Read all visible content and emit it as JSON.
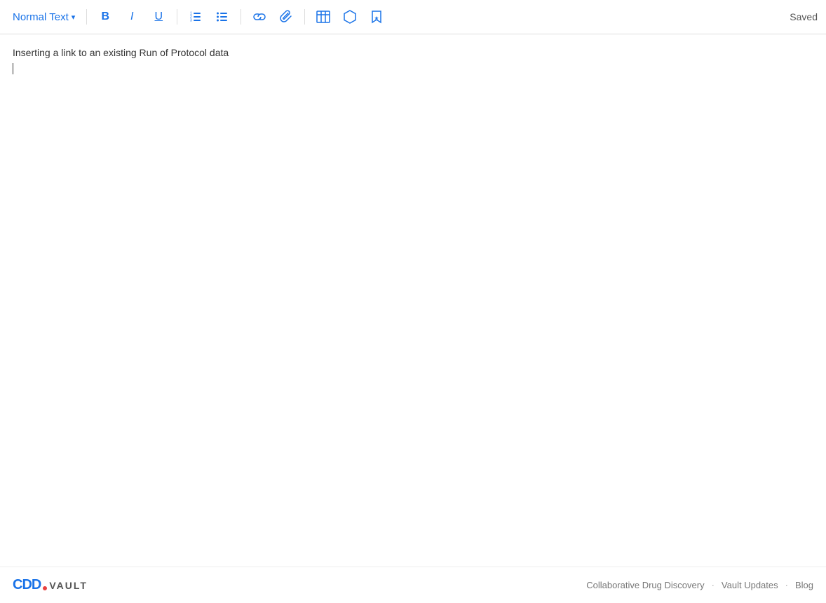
{
  "toolbar": {
    "text_style_label": "Normal Text",
    "chevron": "▾",
    "bold_label": "B",
    "italic_label": "I",
    "underline_label": "U",
    "saved_status": "Saved"
  },
  "editor": {
    "content_line1": "Inserting a link to an existing Run of Protocol data"
  },
  "footer": {
    "logo_cdd": "CDD",
    "logo_vault": "VAULT",
    "link1": "Collaborative Drug Discovery",
    "sep1": "·",
    "link2": "Vault Updates",
    "sep2": "·",
    "link3": "Blog"
  }
}
